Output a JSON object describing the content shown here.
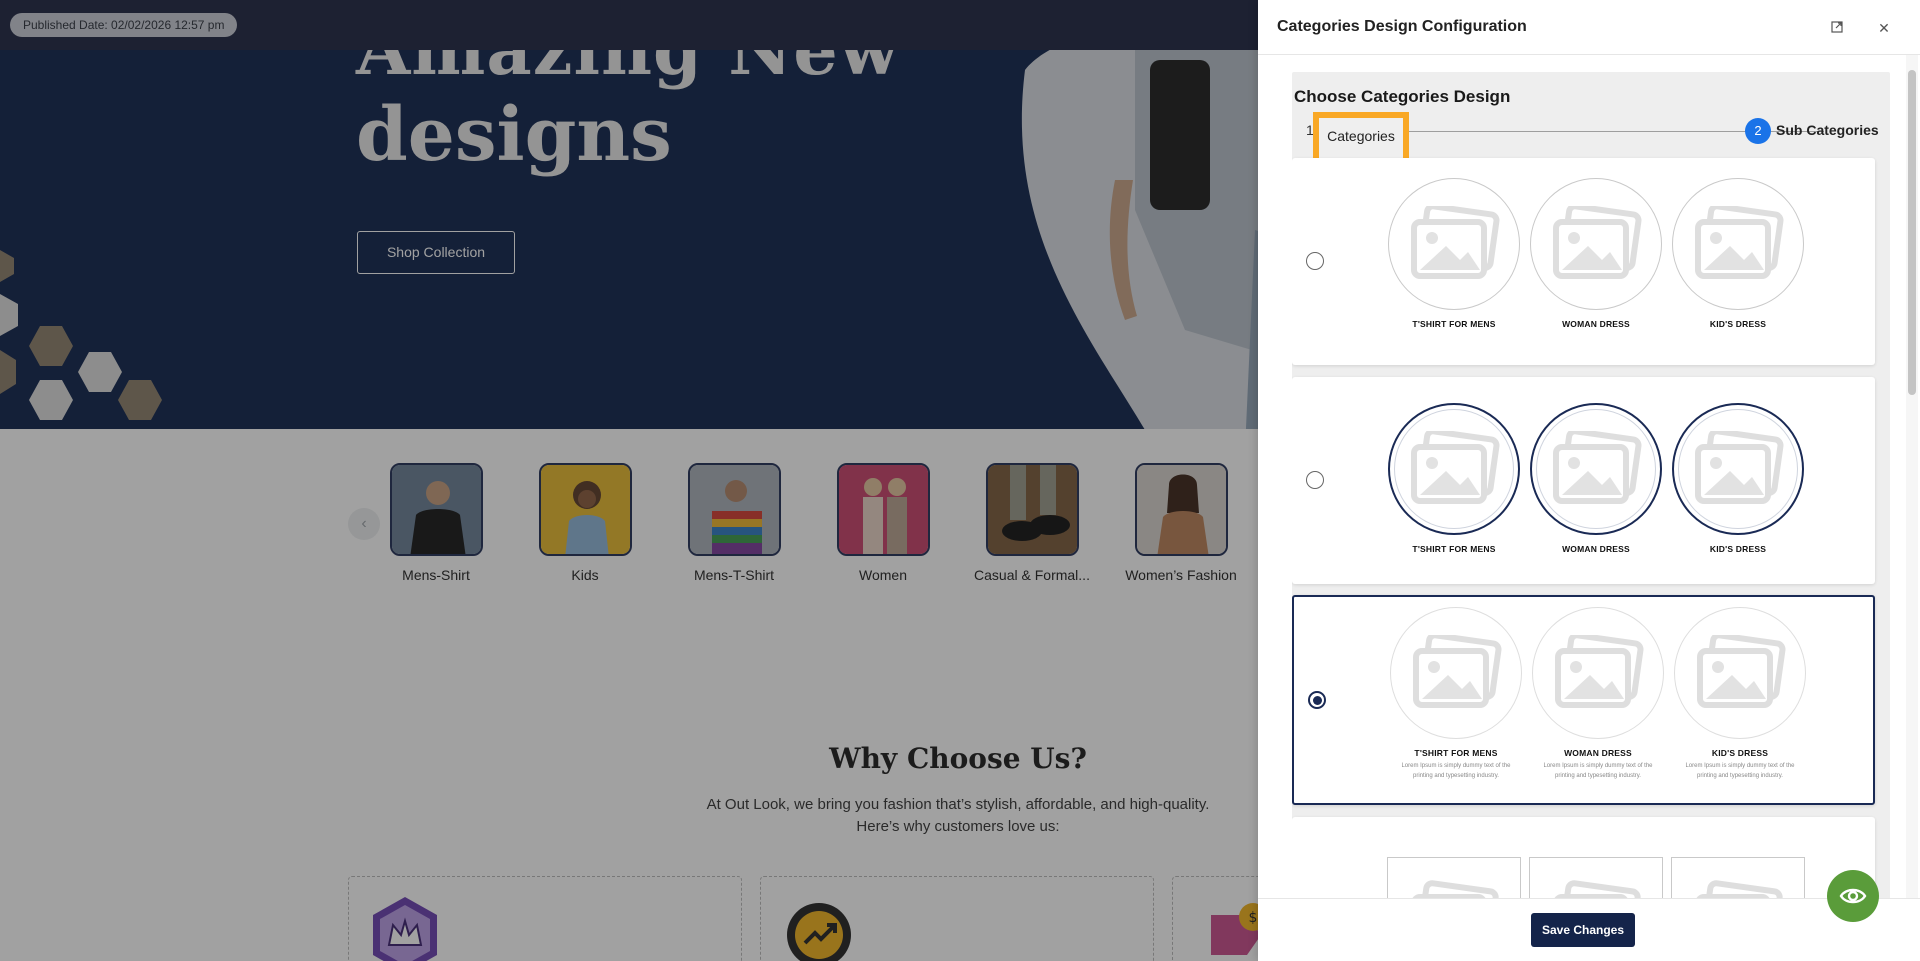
{
  "topbar": {
    "published_label": "Published Date: 02/02/2026 12:57 pm"
  },
  "hero": {
    "title_partial": "Amazing New",
    "title": "designs",
    "cta": "Shop Collection"
  },
  "categories": [
    {
      "label": "Mens-Shirt",
      "color": "#6a7f95"
    },
    {
      "label": "Kids",
      "color": "#e7b82b"
    },
    {
      "label": "Mens-T-Shirt",
      "color": "#a9b0b8"
    },
    {
      "label": "Women",
      "color": "#c9416a"
    },
    {
      "label": "Casual & Formal...",
      "color": "#7a5a3a"
    },
    {
      "label": "Women’s Fashion",
      "color": "#d8d3cd"
    }
  ],
  "why": {
    "title": "Why Choose Us?",
    "line1": "At Out Look, we bring you fashion that’s stylish, affordable, and high-quality.",
    "line2": "Here’s why customers love us:"
  },
  "drawer": {
    "title": "Categories Design Configuration",
    "icons": {
      "minimize": "popout-icon",
      "close": "close-icon"
    },
    "choose_title": "Choose Categories Design",
    "stepper": {
      "step1_number": "1",
      "step1_label": "Categories",
      "step2_number": "2",
      "step2_label": "Sub Categories"
    },
    "designs": [
      {
        "style": "plain-circle",
        "selected": false,
        "items": [
          "T'SHIRT FOR MENS",
          "WOMAN DRESS",
          "KID'S DRESS"
        ]
      },
      {
        "style": "bordered-circle",
        "selected": false,
        "items": [
          "T'SHIRT FOR MENS",
          "WOMAN DRESS",
          "KID'S DRESS"
        ]
      },
      {
        "style": "circle-with-description",
        "selected": true,
        "items": [
          "T'SHIRT FOR MENS",
          "WOMAN DRESS",
          "KID'S DRESS"
        ],
        "desc_line1": "Lorem Ipsum is simply dummy text of the",
        "desc_line2": "printing and typesetting industry."
      },
      {
        "style": "square",
        "selected": false
      }
    ],
    "save_label": "Save Changes"
  },
  "colors": {
    "hero_bg": "#0d214a",
    "accent_navy": "#14244a",
    "step_active": "#1a73e8",
    "highlight": "#f9a825",
    "fab_green": "#5a9c3a"
  }
}
